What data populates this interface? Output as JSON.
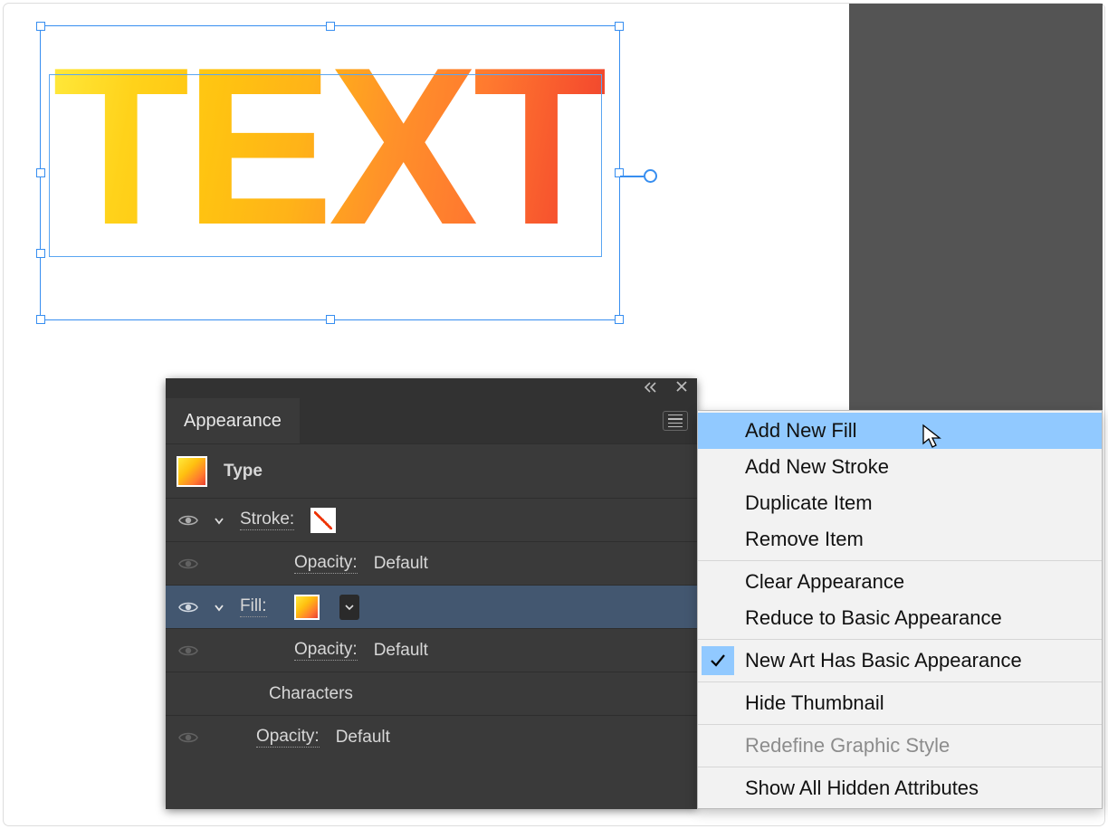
{
  "canvas": {
    "text": "TEXT"
  },
  "panel": {
    "title": "Appearance",
    "type_label": "Type",
    "stroke_label": "Stroke:",
    "fill_label": "Fill:",
    "opacity_label": "Opacity:",
    "opacity_value": "Default",
    "characters_label": "Characters"
  },
  "menu": {
    "items": [
      "Add New Fill",
      "Add New Stroke",
      "Duplicate Item",
      "Remove Item",
      "Clear Appearance",
      "Reduce to Basic Appearance",
      "New Art Has Basic Appearance",
      "Hide Thumbnail",
      "Redefine Graphic Style",
      "Show All Hidden Attributes"
    ]
  }
}
